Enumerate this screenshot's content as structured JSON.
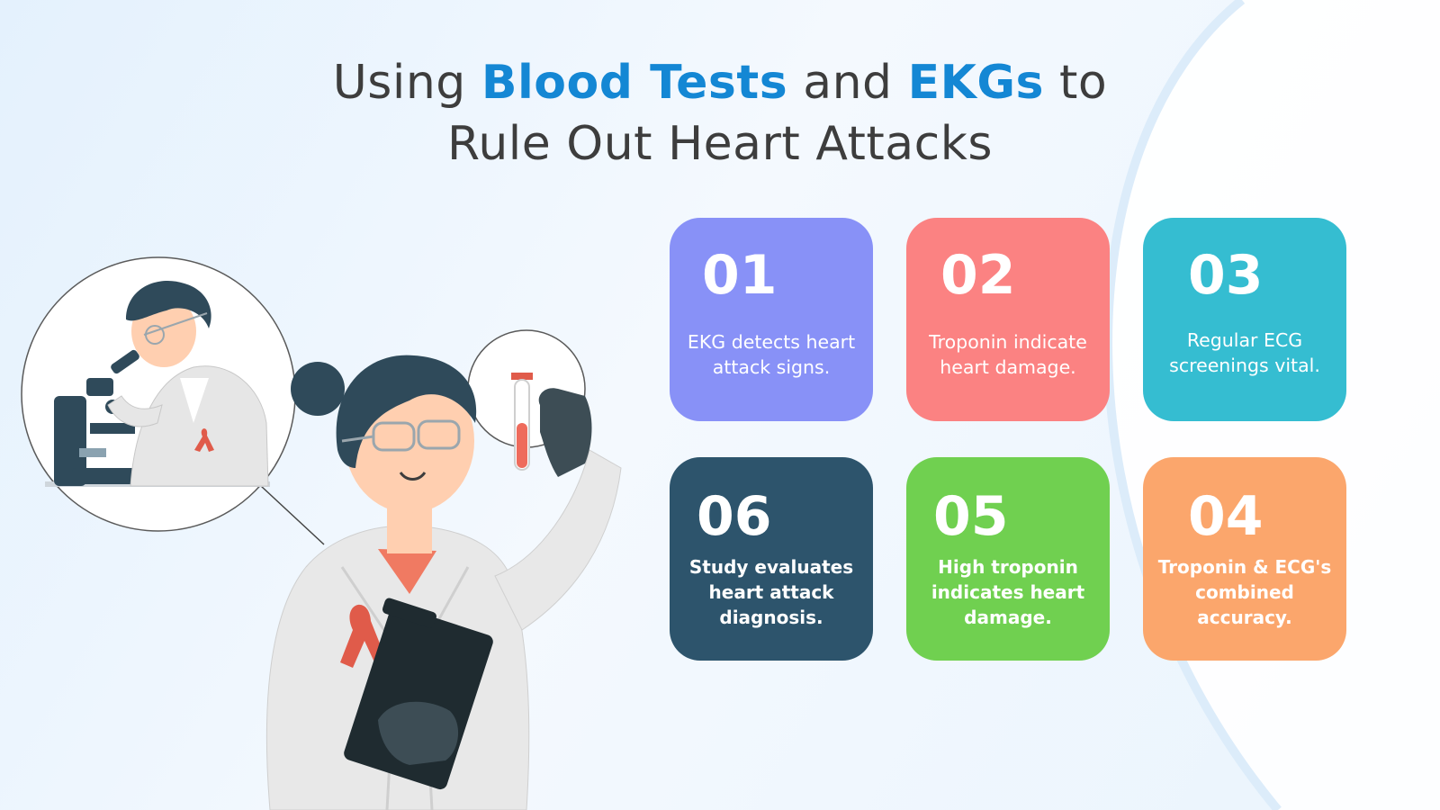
{
  "title": {
    "line1": {
      "pre": "Using ",
      "hl1": "Blood Tests",
      "mid": " and ",
      "hl2": "EKGs",
      "post": " to"
    },
    "line2": "Rule Out Heart Attacks",
    "highlight_color": "#1487d4",
    "text_color": "#3d3d3d"
  },
  "cards": [
    {
      "num": "01",
      "text": "EKG detects heart attack signs.",
      "color": "#8891f7"
    },
    {
      "num": "02",
      "text": "Troponin indicate heart damage.",
      "color": "#fb8282"
    },
    {
      "num": "03",
      "text": "Regular ECG screenings vital.",
      "color": "#35bdd1"
    },
    {
      "num": "06",
      "text": "Study evaluates heart attack diagnosis.",
      "color": "#2d546c"
    },
    {
      "num": "05",
      "text": "High troponin indicates heart damage.",
      "color": "#70d050"
    },
    {
      "num": "04",
      "text": "Troponin & ECG's combined accuracy.",
      "color": "#fba66c"
    }
  ],
  "illustration": {
    "icons": [
      "scientist-with-microscope-icon",
      "scientist-holding-test-tube-icon",
      "test-tube-icon",
      "awareness-ribbon-icon",
      "clipboard-icon"
    ]
  }
}
